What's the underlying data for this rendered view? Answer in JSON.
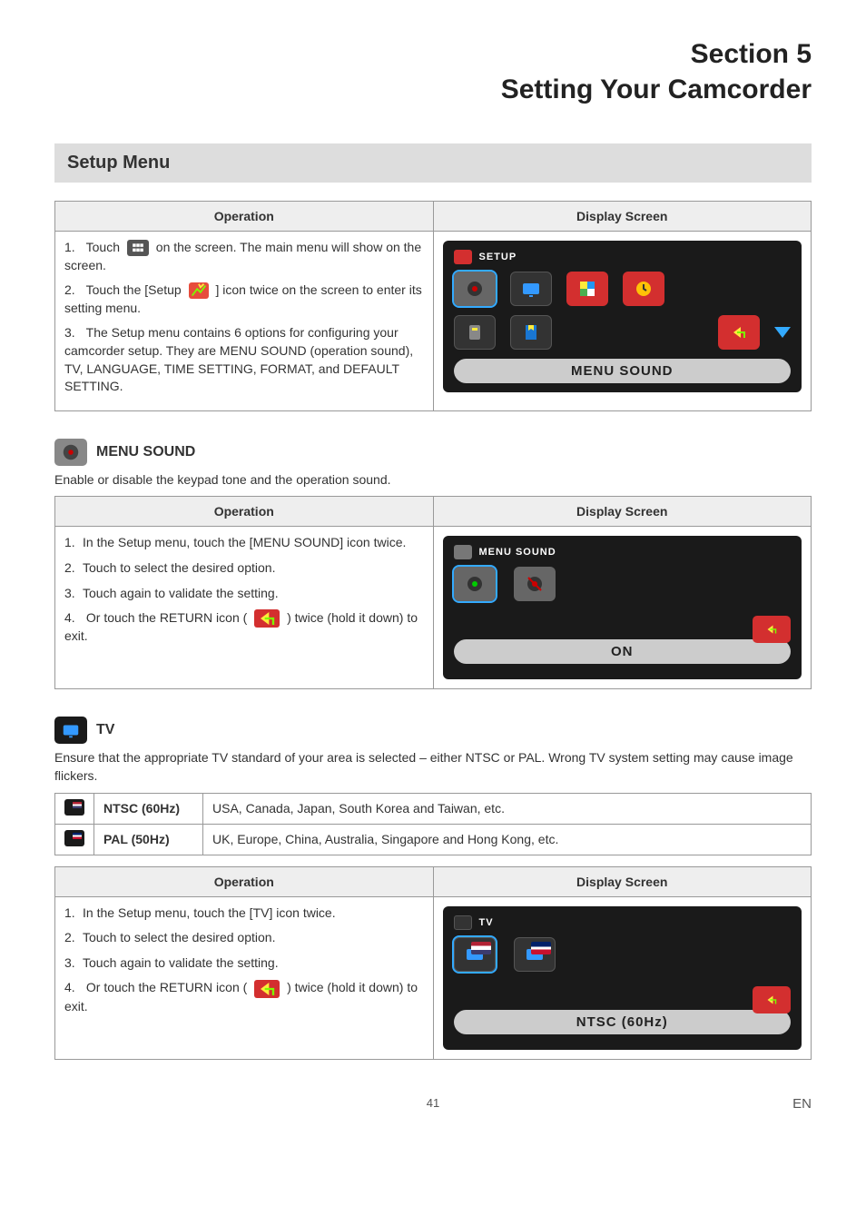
{
  "header": {
    "section_label": "Section 5",
    "title": "Setting Your Camcorder"
  },
  "setup_menu": {
    "bar_title": "Setup Menu",
    "col_operation": "Operation",
    "col_display": "Display Screen",
    "steps": {
      "s1a": "Touch",
      "s1b": "on the screen. The main menu will show on the screen.",
      "s2a": "Touch the [Setup",
      "s2b": "] icon twice on the screen to enter its setting menu.",
      "s3": "The Setup menu contains 6 options for configuring your camcorder setup. They are MENU SOUND (operation sound), TV, LANGUAGE, TIME SETTING, FORMAT, and DEFAULT SETTING."
    },
    "display": {
      "header": "SETUP",
      "caption": "MENU SOUND"
    }
  },
  "menu_sound": {
    "heading": "MENU SOUND",
    "desc": "Enable or disable the keypad tone and the operation sound.",
    "col_operation": "Operation",
    "col_display": "Display Screen",
    "steps": {
      "s1": "In the Setup menu, touch the [MENU SOUND] icon twice.",
      "s2": "Touch to select the desired option.",
      "s3": "Touch again to validate the setting.",
      "s4a": "Or touch the RETURN icon (",
      "s4b": ") twice (hold it down) to exit."
    },
    "display": {
      "header": "MENU SOUND",
      "caption": "ON"
    }
  },
  "tv": {
    "heading": "TV",
    "desc": "Ensure that the appropriate TV standard of your area is selected – either NTSC or PAL. Wrong TV system setting may cause image flickers.",
    "rows": {
      "ntsc_name": "NTSC (60Hz)",
      "ntsc_desc": "USA, Canada, Japan, South Korea and Taiwan, etc.",
      "pal_name": "PAL (50Hz)",
      "pal_desc": "UK, Europe, China, Australia, Singapore and Hong Kong, etc."
    },
    "col_operation": "Operation",
    "col_display": "Display Screen",
    "steps": {
      "s1": "In the Setup menu, touch the [TV] icon twice.",
      "s2": "Touch to select the desired option.",
      "s3": "Touch again to validate the setting.",
      "s4a": "Or touch the RETURN icon (",
      "s4b": ") twice (hold it down) to exit."
    },
    "display": {
      "header": "TV",
      "caption": "NTSC (60Hz)"
    }
  },
  "footer": {
    "page": "41",
    "lang": "EN"
  }
}
